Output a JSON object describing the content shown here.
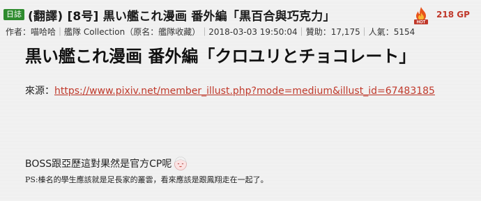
{
  "post": {
    "category_badge": "日誌",
    "title": "(翻譯) [8号] 黒い艦これ漫画 番外編「黒百合與巧克力」",
    "gp": "218 GP",
    "hot_icon": "hot-fire-icon"
  },
  "meta": {
    "author_label": "作者：",
    "author": "喵哈哈",
    "category_label": "艦隊 Collection（原名：艦隊收藏）",
    "date": "2018-03-03 19:50:04",
    "support_label": "贊助：",
    "support": "17,175",
    "popularity_label": "人氣：",
    "popularity": "5154"
  },
  "article": {
    "title": "黒い艦これ漫画 番外編「クロユリとチョコレート」",
    "source_label": "來源：",
    "source_url": "https://www.pixiv.net/member_illust.php?mode=medium&illust_id=67483185",
    "body_text": "BOSS跟亞歷這對果然是官方CP呢",
    "emoji_icon": "smiling-face-emoji-icon",
    "ps_text": "PS:榛名的學生應該就是足長家的叢雲，看來應該是跟鳳翔走在一起了。"
  },
  "colors": {
    "badge_bg": "#2e8b2e",
    "gp_color": "#c0392b",
    "link_color": "#c0392b"
  }
}
